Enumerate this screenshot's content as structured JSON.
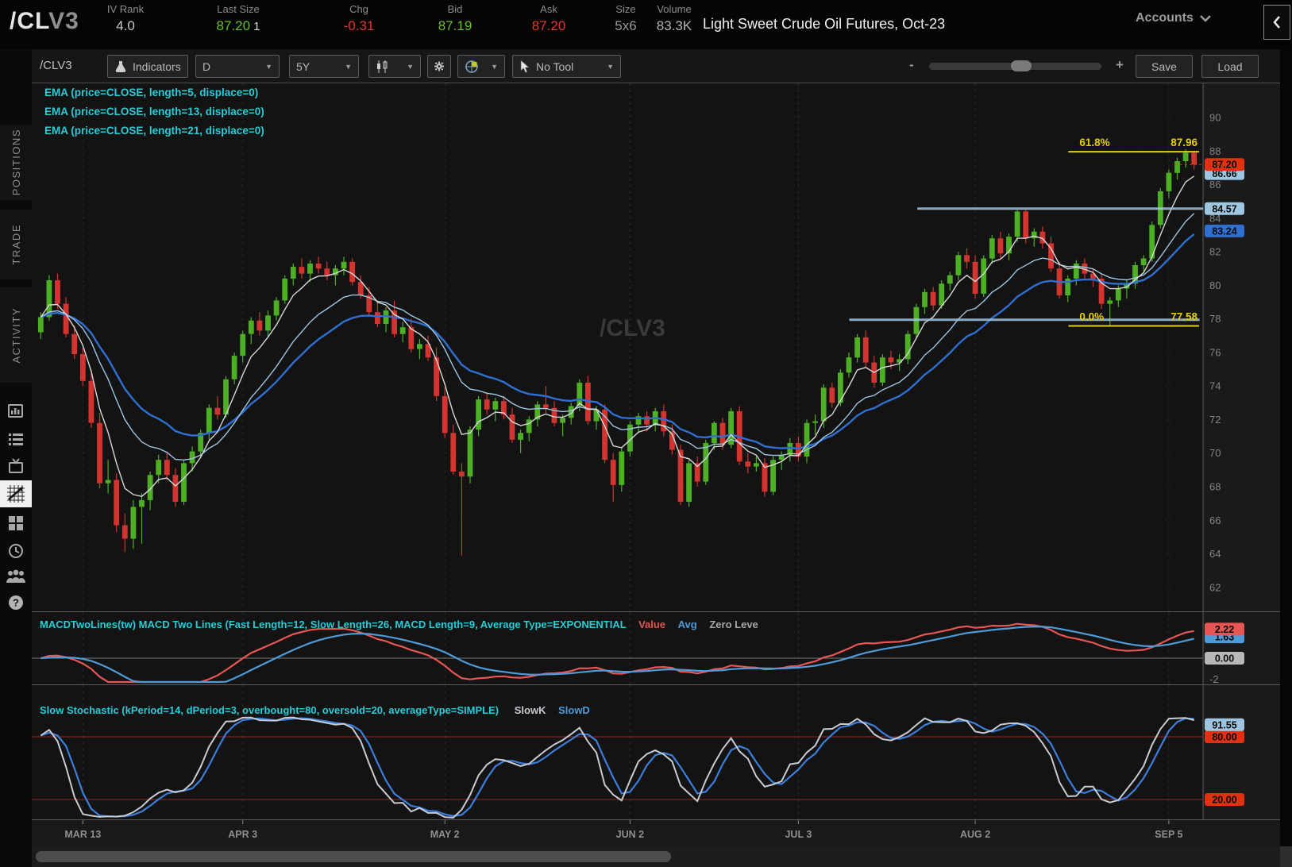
{
  "header": {
    "symbol_prefix": "/CL",
    "symbol_suffix": "V3",
    "fields": [
      {
        "label": "IV Rank",
        "value": "4.0",
        "color": "#c8c8c8"
      },
      {
        "label": "Last Size",
        "value": "87.20",
        "extra": "1",
        "color": "#6abf2a"
      },
      {
        "label": "Chg",
        "value": "-0.31",
        "color": "#e0382e"
      },
      {
        "label": "Bid",
        "value": "87.19",
        "color": "#6abf2a"
      },
      {
        "label": "Ask",
        "value": "87.20",
        "color": "#e0382e"
      },
      {
        "label": "Size",
        "value": "5x6",
        "color": "#9a9a9a"
      },
      {
        "label": "Volume",
        "value": "83.3K",
        "color": "#b4b4b4"
      }
    ],
    "description": "Light Sweet Crude Oil Futures, Oct-23",
    "accounts_label": "Accounts"
  },
  "sidebar": {
    "tabs": [
      {
        "label": "POSITIONS"
      },
      {
        "label": "TRADE"
      },
      {
        "label": "ACTIVITY"
      }
    ],
    "icons": [
      {
        "name": "news-icon",
        "active": false
      },
      {
        "name": "watchlist-icon",
        "active": false
      },
      {
        "name": "tv-icon",
        "active": false
      },
      {
        "name": "chart-icon",
        "active": true
      },
      {
        "name": "grid-icon",
        "active": false
      },
      {
        "name": "history-icon",
        "active": false
      },
      {
        "name": "community-icon",
        "active": false
      },
      {
        "name": "help-icon",
        "active": false
      }
    ]
  },
  "toolbar": {
    "symbol": "/CLV3",
    "indicators": "Indicators",
    "timeframe": "D",
    "range": "5Y",
    "tool": "No Tool",
    "zoom_minus": "-",
    "zoom_plus": "+",
    "save": "Save",
    "load": "Load"
  },
  "studies": {
    "ema_labels": [
      "EMA (price=CLOSE, length=5, displace=0)",
      "EMA (price=CLOSE, length=13, displace=0)",
      "EMA (price=CLOSE, length=21, displace=0)"
    ],
    "macd": {
      "title": "MACDTwoLines(tw) MACD Two Lines (Fast Length=12, Slow Length=26, MACD Length=9, Average Type=EXPONENTIAL",
      "value_label": "Value",
      "avg_label": "Avg",
      "zero_label": "Zero Leve"
    },
    "stoch": {
      "title": "Slow Stochastic (kPeriod=14, dPeriod=3, overbought=80, oversold=20, averageType=SIMPLE)",
      "slowk_label": "SlowK",
      "slowd_label": "SlowD"
    }
  },
  "chart_data": {
    "type": "candlestick",
    "symbol": "/CLV3",
    "watermark": "/CLV3",
    "price_axis": {
      "min": 62,
      "max": 90,
      "tick_step": 2
    },
    "x_axis": {
      "labels": [
        {
          "text": "MAR 13",
          "index": 5
        },
        {
          "text": "APR 3",
          "index": 24
        },
        {
          "text": "MAY 2",
          "index": 48
        },
        {
          "text": "JUN 2",
          "index": 70
        },
        {
          "text": "JUL 3",
          "index": 90
        },
        {
          "text": "AUG 2",
          "index": 111
        },
        {
          "text": "SEP 5",
          "index": 134
        }
      ]
    },
    "candles": [
      [
        77.2,
        78.4,
        76.8,
        78.1
      ],
      [
        78.1,
        80.6,
        77.9,
        80.3
      ],
      [
        80.3,
        80.7,
        78.6,
        78.9
      ],
      [
        78.9,
        79.3,
        76.9,
        77.1
      ],
      [
        77.1,
        77.6,
        75.6,
        75.9
      ],
      [
        75.9,
        76.3,
        74.0,
        74.3
      ],
      [
        74.3,
        75.0,
        71.5,
        71.8
      ],
      [
        71.8,
        72.4,
        67.9,
        68.2
      ],
      [
        68.2,
        69.6,
        67.6,
        68.4
      ],
      [
        68.4,
        68.8,
        65.3,
        65.7
      ],
      [
        65.7,
        66.4,
        64.1,
        64.9
      ],
      [
        64.9,
        67.2,
        64.3,
        66.8
      ],
      [
        66.8,
        67.6,
        64.6,
        67.2
      ],
      [
        67.2,
        68.9,
        66.6,
        68.7
      ],
      [
        68.7,
        69.9,
        68.2,
        69.6
      ],
      [
        69.6,
        70.1,
        68.4,
        68.7
      ],
      [
        68.7,
        69.1,
        66.8,
        67.1
      ],
      [
        67.1,
        69.6,
        66.9,
        69.4
      ],
      [
        69.4,
        70.4,
        68.9,
        70.1
      ],
      [
        70.1,
        71.4,
        69.7,
        71.2
      ],
      [
        71.2,
        72.9,
        70.8,
        72.7
      ],
      [
        72.7,
        73.4,
        72.0,
        72.3
      ],
      [
        72.3,
        74.6,
        72.1,
        74.4
      ],
      [
        74.4,
        76.0,
        74.1,
        75.8
      ],
      [
        75.8,
        77.3,
        75.4,
        77.1
      ],
      [
        77.1,
        78.1,
        76.5,
        77.9
      ],
      [
        77.9,
        78.4,
        77.0,
        77.3
      ],
      [
        77.3,
        78.5,
        76.9,
        78.2
      ],
      [
        78.2,
        79.3,
        77.9,
        79.1
      ],
      [
        79.1,
        80.6,
        78.9,
        80.4
      ],
      [
        80.4,
        81.3,
        80.0,
        81.1
      ],
      [
        81.1,
        81.6,
        80.4,
        80.7
      ],
      [
        80.7,
        81.5,
        80.2,
        81.3
      ],
      [
        81.3,
        81.7,
        80.7,
        81.0
      ],
      [
        81.0,
        81.4,
        80.3,
        80.6
      ],
      [
        80.6,
        81.2,
        80.0,
        81.0
      ],
      [
        81.0,
        81.7,
        80.6,
        81.4
      ],
      [
        81.4,
        81.6,
        80.0,
        80.2
      ],
      [
        80.2,
        80.6,
        79.2,
        79.4
      ],
      [
        79.4,
        79.9,
        78.2,
        78.4
      ],
      [
        78.4,
        79.0,
        77.5,
        77.7
      ],
      [
        77.7,
        78.7,
        77.2,
        78.5
      ],
      [
        78.5,
        79.1,
        76.9,
        77.1
      ],
      [
        77.1,
        77.8,
        76.6,
        77.5
      ],
      [
        77.5,
        78.0,
        76.0,
        76.2
      ],
      [
        76.2,
        76.8,
        75.6,
        76.5
      ],
      [
        76.5,
        77.0,
        75.5,
        75.7
      ],
      [
        75.7,
        76.3,
        73.1,
        73.4
      ],
      [
        73.4,
        73.9,
        70.9,
        71.2
      ],
      [
        71.2,
        71.7,
        68.7,
        68.9
      ],
      [
        68.9,
        69.4,
        63.9,
        68.6
      ],
      [
        68.6,
        71.6,
        68.2,
        71.4
      ],
      [
        71.4,
        73.4,
        71.0,
        73.2
      ],
      [
        73.2,
        73.6,
        72.3,
        72.6
      ],
      [
        72.6,
        73.3,
        71.9,
        73.1
      ],
      [
        73.1,
        73.4,
        72.0,
        72.3
      ],
      [
        72.3,
        72.7,
        70.6,
        70.8
      ],
      [
        70.8,
        71.4,
        70.0,
        71.2
      ],
      [
        71.2,
        72.2,
        70.7,
        72.0
      ],
      [
        72.0,
        73.1,
        71.6,
        72.9
      ],
      [
        72.9,
        74.0,
        72.4,
        72.7
      ],
      [
        72.7,
        73.1,
        71.6,
        71.8
      ],
      [
        71.8,
        72.3,
        71.0,
        72.1
      ],
      [
        72.1,
        73.0,
        71.7,
        72.8
      ],
      [
        72.8,
        74.4,
        72.5,
        74.2
      ],
      [
        74.2,
        74.6,
        71.7,
        71.9
      ],
      [
        71.9,
        72.8,
        71.4,
        72.6
      ],
      [
        72.6,
        72.9,
        69.4,
        69.6
      ],
      [
        69.6,
        70.0,
        67.1,
        68.1
      ],
      [
        68.1,
        70.3,
        67.7,
        70.1
      ],
      [
        70.1,
        71.9,
        69.8,
        71.7
      ],
      [
        71.7,
        72.4,
        71.2,
        72.2
      ],
      [
        72.2,
        72.5,
        71.3,
        71.7
      ],
      [
        71.7,
        72.7,
        71.3,
        72.5
      ],
      [
        72.5,
        72.9,
        71.0,
        71.3
      ],
      [
        71.3,
        71.7,
        69.9,
        70.2
      ],
      [
        70.2,
        70.5,
        66.9,
        67.1
      ],
      [
        67.1,
        69.6,
        66.8,
        69.4
      ],
      [
        69.4,
        69.8,
        68.0,
        68.3
      ],
      [
        68.3,
        70.8,
        68.1,
        70.6
      ],
      [
        70.6,
        71.9,
        70.2,
        71.8
      ],
      [
        71.8,
        72.1,
        70.2,
        70.5
      ],
      [
        70.5,
        72.7,
        70.3,
        72.5
      ],
      [
        72.5,
        72.8,
        69.3,
        69.5
      ],
      [
        69.5,
        70.0,
        68.8,
        69.2
      ],
      [
        69.2,
        69.8,
        68.9,
        69.4
      ],
      [
        69.4,
        69.7,
        67.4,
        67.7
      ],
      [
        67.7,
        69.8,
        67.5,
        69.6
      ],
      [
        69.6,
        70.1,
        69.0,
        69.9
      ],
      [
        69.9,
        70.9,
        69.5,
        70.6
      ],
      [
        70.6,
        71.0,
        69.5,
        69.8
      ],
      [
        69.8,
        72.0,
        69.4,
        71.8
      ],
      [
        71.8,
        72.3,
        71.1,
        71.9
      ],
      [
        71.9,
        74.1,
        71.5,
        73.9
      ],
      [
        73.9,
        74.2,
        72.7,
        73.0
      ],
      [
        73.0,
        75.0,
        72.8,
        74.8
      ],
      [
        74.8,
        76.0,
        74.5,
        75.7
      ],
      [
        75.7,
        77.1,
        75.4,
        76.9
      ],
      [
        76.9,
        77.3,
        75.1,
        75.4
      ],
      [
        75.4,
        75.8,
        73.9,
        74.2
      ],
      [
        74.2,
        75.9,
        74.0,
        75.7
      ],
      [
        75.7,
        76.1,
        75.0,
        75.4
      ],
      [
        75.4,
        75.9,
        74.9,
        75.6
      ],
      [
        75.6,
        77.3,
        75.3,
        77.1
      ],
      [
        77.1,
        78.9,
        76.8,
        78.7
      ],
      [
        78.7,
        79.8,
        78.3,
        79.6
      ],
      [
        79.6,
        79.9,
        78.5,
        78.8
      ],
      [
        78.8,
        80.3,
        78.6,
        80.1
      ],
      [
        80.1,
        80.8,
        79.7,
        80.6
      ],
      [
        80.6,
        82.0,
        80.3,
        81.8
      ],
      [
        81.8,
        82.2,
        81.0,
        81.4
      ],
      [
        81.4,
        81.8,
        79.2,
        79.5
      ],
      [
        79.5,
        81.8,
        79.3,
        81.6
      ],
      [
        81.6,
        83.0,
        81.3,
        82.8
      ],
      [
        82.8,
        83.2,
        81.6,
        81.9
      ],
      [
        81.9,
        83.1,
        81.5,
        82.9
      ],
      [
        82.9,
        84.57,
        82.6,
        84.4
      ],
      [
        84.4,
        84.5,
        82.5,
        82.8
      ],
      [
        82.8,
        83.4,
        82.3,
        83.2
      ],
      [
        83.2,
        83.5,
        82.2,
        82.5
      ],
      [
        82.5,
        82.9,
        80.8,
        81.0
      ],
      [
        81.0,
        81.4,
        79.2,
        79.4
      ],
      [
        79.4,
        80.6,
        79.0,
        80.4
      ],
      [
        80.4,
        81.5,
        80.0,
        81.3
      ],
      [
        81.3,
        81.6,
        80.4,
        80.7
      ],
      [
        80.7,
        81.0,
        79.9,
        80.4
      ],
      [
        80.4,
        80.7,
        78.6,
        78.9
      ],
      [
        78.9,
        79.3,
        77.6,
        79.1
      ],
      [
        79.1,
        80.0,
        78.7,
        79.8
      ],
      [
        79.8,
        80.3,
        79.2,
        80.1
      ],
      [
        80.1,
        81.4,
        79.8,
        81.2
      ],
      [
        81.2,
        81.8,
        80.8,
        81.6
      ],
      [
        81.6,
        83.8,
        81.4,
        83.6
      ],
      [
        83.6,
        85.8,
        83.4,
        85.6
      ],
      [
        85.6,
        86.9,
        85.2,
        86.7
      ],
      [
        86.7,
        87.6,
        86.3,
        87.4
      ],
      [
        87.4,
        88.1,
        87.0,
        87.9
      ],
      [
        87.9,
        88.0,
        86.9,
        87.2
      ]
    ],
    "colors": {
      "up": "#4caf24",
      "down": "#d23430",
      "ema5": "#d8d8d8",
      "ema13": "#9fc6e0",
      "ema21": "#2f6fd0"
    },
    "overlays": [
      {
        "name": "EMA 5",
        "length": 5
      },
      {
        "name": "EMA 13",
        "length": 13
      },
      {
        "name": "EMA 21",
        "length": 21
      }
    ],
    "price_badges": [
      {
        "text": "86.66",
        "price": 86.66,
        "bg": "#9fc6e0",
        "type": "ema13"
      },
      {
        "text": "84.57",
        "price": 84.57,
        "bg": "#9fc6e0",
        "type": "drawing"
      },
      {
        "text": "83.24",
        "price": 83.24,
        "bg": "#2f6fd0",
        "type": "ema21"
      },
      {
        "text": "87.20",
        "price": 87.2,
        "bg": "#e03210",
        "type": "last"
      }
    ],
    "drawings": {
      "fib_levels": [
        {
          "label": "61.8%",
          "value_label": "87.96",
          "price": 87.96,
          "x_start_frac": 0.885
        },
        {
          "label": "0.0%",
          "value_label": "77.58",
          "price": 77.58,
          "x_start_frac": 0.885
        }
      ],
      "horizontal_lines": [
        {
          "price": 84.57,
          "x_start_frac": 0.756,
          "x_end_frac": 1.0,
          "color": "#9fc6e0"
        },
        {
          "price": 77.95,
          "x_start_frac": 0.698,
          "x_end_frac": 0.997,
          "color": "#9fc6e0"
        }
      ]
    },
    "macd": {
      "params": {
        "fast": 12,
        "slow": 26,
        "length": 9
      },
      "value_badge": "2.22",
      "avg_badge": "1.63",
      "zero_badge": "0.00",
      "axis_ticks": [
        "2",
        "-2"
      ],
      "value_color": "#e85555",
      "avg_color": "#4f9bd8",
      "zero_color": "#b8b8b8"
    },
    "stochastic": {
      "params": {
        "kPeriod": 14,
        "dPeriod": 3
      },
      "overbought": 80,
      "oversold": 20,
      "slowd_badge": "91.55",
      "overbought_badge": "80.00",
      "oversold_badge": "20.00",
      "slowk_color": "#c8ccd2",
      "slowd_color": "#3d7edb"
    }
  }
}
